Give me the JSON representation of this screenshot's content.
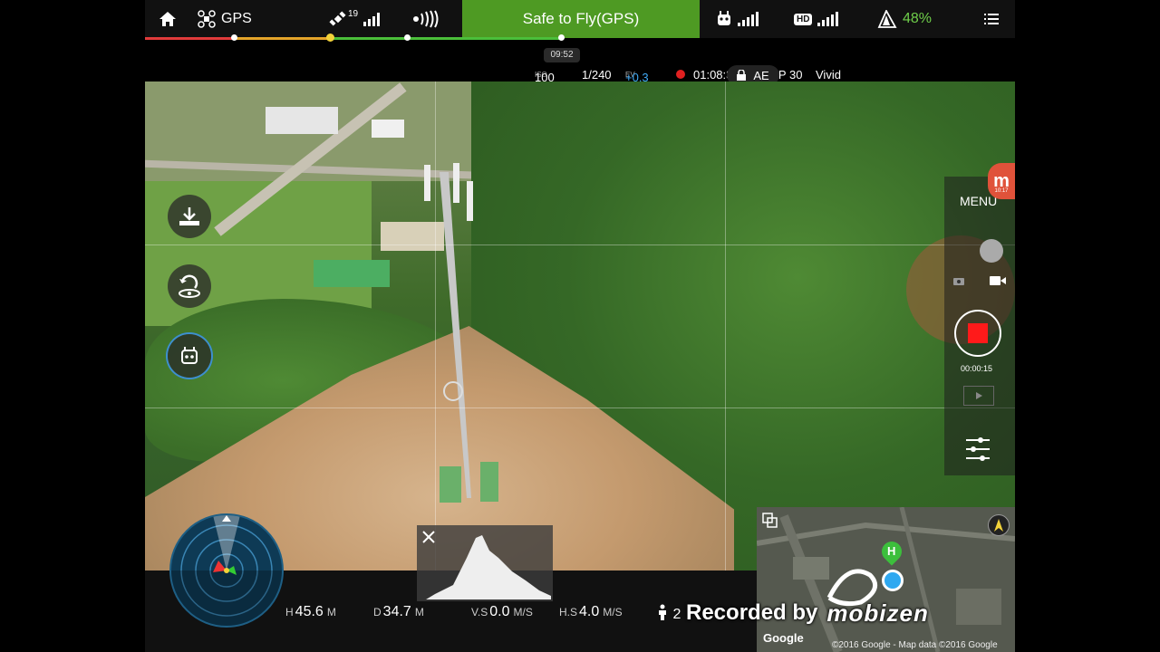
{
  "topbar": {
    "gps_label": "GPS",
    "satellite_count": "19",
    "status": "Safe to Fly(GPS)",
    "hd_label": "HD",
    "battery": "48%",
    "flight_time_chip": "09:52"
  },
  "camera": {
    "iso_label": "ISO",
    "iso": "100",
    "shutter": "1/240",
    "ev_label": "EV",
    "ev": "+0.3",
    "remaining_time": "01:08:33",
    "video_format": "1080P 30",
    "color_profile": "Vivid",
    "ae_label": "AE"
  },
  "right_panel": {
    "menu_label": "MENU",
    "record_duration": "00:00:15"
  },
  "telemetry": {
    "height_label": "H",
    "height_value": "45.6",
    "height_unit": "M",
    "distance_label": "D",
    "distance_value": "34.7",
    "distance_unit": "M",
    "vs_label": "V.S",
    "vs_value": "0.0",
    "vs_unit": "M/S",
    "hs_label": "H.S",
    "hs_value": "4.0",
    "hs_unit": "M/S",
    "extra_value": "2"
  },
  "map": {
    "home_marker": "H",
    "google_logo": "Google",
    "credit": "©2016 Google - Map data ©2016 Google"
  },
  "watermark": {
    "text": "Recorded by",
    "brand": "mobizen",
    "badge_time": "10:17"
  },
  "colors": {
    "safe_green": "#4e9a23",
    "record_red": "#ff1a1a",
    "battery_green": "#6fcf4a",
    "ev_blue": "#3fa9f5"
  }
}
